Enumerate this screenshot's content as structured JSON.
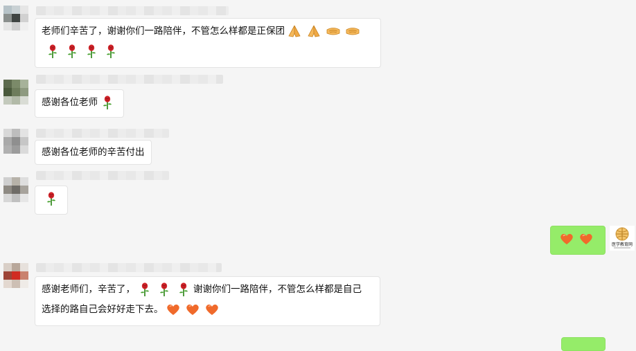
{
  "messages": [
    {
      "id": "m1",
      "side": "left",
      "lines": [
        "老师们辛苦了，谢谢你们一路陪伴，不管怎么样都是正保团"
      ],
      "emoji_inline": [
        "pray",
        "pray",
        "handshake",
        "handshake"
      ],
      "emoji_line2": [
        "rose",
        "rose",
        "rose",
        "rose"
      ]
    },
    {
      "id": "m2",
      "side": "left",
      "text": "感谢各位老师",
      "emoji": [
        "rose"
      ]
    },
    {
      "id": "m3",
      "side": "left",
      "text": "感谢各位老师的辛苦付出"
    },
    {
      "id": "m4",
      "side": "left",
      "emoji": [
        "rose"
      ]
    },
    {
      "id": "m5",
      "side": "right",
      "emoji": [
        "heart",
        "heart"
      ]
    },
    {
      "id": "m6",
      "side": "left",
      "line1_a": "感谢老师们，辛苦了，",
      "line1_b": "谢谢你们一路陪伴，不管怎么样都是自己",
      "line2": "选择的路自己会好好走下去。"
    }
  ],
  "logo_text": "医学教育网",
  "colors": {
    "background": "#f5f5f5",
    "bubble_self": "#95ec69",
    "bubble_other": "#ffffff",
    "heart": "#f06a2b",
    "rose": "#d4242a"
  }
}
